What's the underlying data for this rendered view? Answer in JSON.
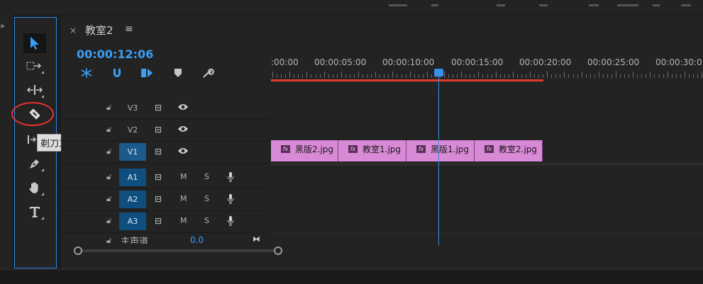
{
  "sequence": {
    "tab_title": "教室2",
    "close_symbol": "×",
    "menu_symbol": "≡",
    "timecode": "00:00:12:06"
  },
  "tooltip": "剃刀工具 (C)",
  "tools": [
    {
      "name": "selection-tool-icon",
      "selected": true
    },
    {
      "name": "track-select-forward-icon"
    },
    {
      "name": "ripple-edit-icon"
    },
    {
      "name": "razor-tool-icon"
    },
    {
      "name": "slip-tool-icon"
    },
    {
      "name": "pen-tool-icon"
    },
    {
      "name": "hand-tool-icon"
    },
    {
      "name": "type-tool-icon"
    }
  ],
  "ruler_labels": [
    ":00:00",
    "00:00:05:00",
    "00:00:10:00",
    "00:00:15:00",
    "00:00:20:00",
    "00:00:25:00",
    "00:00:30:0"
  ],
  "tracks": {
    "video": [
      {
        "label": "V3"
      },
      {
        "label": "V2"
      },
      {
        "label": "V1",
        "targeted": true
      }
    ],
    "audio": [
      {
        "label": "A1",
        "m": "M",
        "s": "S"
      },
      {
        "label": "A2",
        "m": "M",
        "s": "S"
      },
      {
        "label": "A3",
        "m": "M",
        "s": "S"
      }
    ],
    "master": {
      "label": "主声道",
      "value": "0.0"
    }
  },
  "clips": [
    {
      "name": "黑版2.jpg",
      "fx": "fx"
    },
    {
      "name": "教室1.jpg",
      "fx": "fx"
    },
    {
      "name": "黑版1.jpg",
      "fx": "fx"
    },
    {
      "name": "教室2.jpg",
      "fx": "fx"
    }
  ],
  "colors": {
    "accent": "#3a9ff5",
    "clip": "#d98ad6",
    "workarea": "#e43a2c",
    "highlight_circle": "#e8322c"
  }
}
